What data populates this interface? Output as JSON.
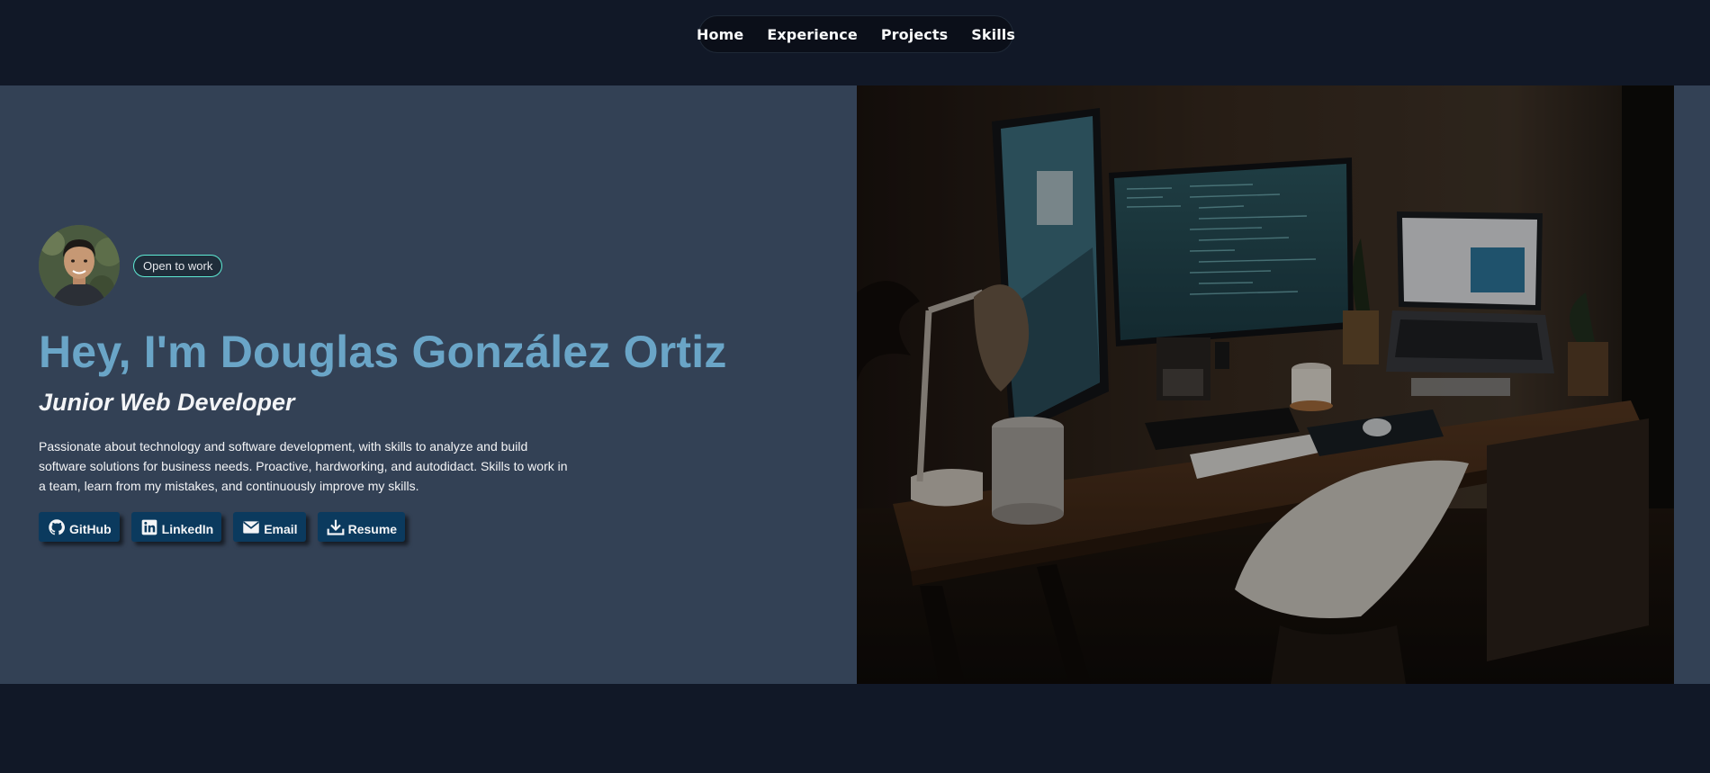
{
  "nav": {
    "links": [
      {
        "label": "Home"
      },
      {
        "label": "Experience"
      },
      {
        "label": "Projects"
      },
      {
        "label": "Skills"
      }
    ]
  },
  "hero": {
    "status_badge": "Open to work",
    "title": "Hey, I'm Douglas González Ortiz",
    "subtitle": "Junior Web Developer",
    "description": "Passionate about technology and software development, with skills to analyze and build software solutions for business needs. Proactive, hardworking, and autodidact. Skills to work in a team, learn from my mistakes, and continuously improve my skills.",
    "links": [
      {
        "label": "GitHub",
        "icon": "github-icon"
      },
      {
        "label": "LinkedIn",
        "icon": "linkedin-icon"
      },
      {
        "label": "Email",
        "icon": "mail-icon"
      },
      {
        "label": "Resume",
        "icon": "download-icon"
      }
    ]
  },
  "colors": {
    "page_bg": "#111827",
    "hero_bg": "#334155",
    "title_accent": "#6aa5c7",
    "button_bg": "#0b3a5e",
    "badge_border": "#5eead4"
  }
}
